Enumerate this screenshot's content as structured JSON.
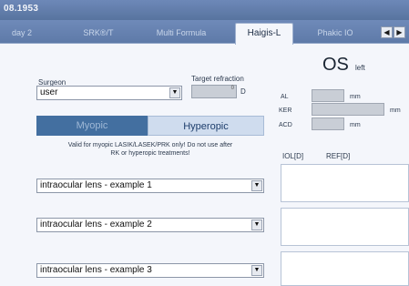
{
  "window": {
    "title": "08.1953"
  },
  "tabs": [
    {
      "label": "day 2"
    },
    {
      "label": "SRK®/T"
    },
    {
      "label": "Multi Formula"
    },
    {
      "label": "Haigis-L"
    },
    {
      "label": "Phakic IO"
    }
  ],
  "tab_nav": {
    "prev": "◀",
    "next": "▶"
  },
  "surgeon": {
    "label": "Surgeon",
    "value": "user"
  },
  "target_refraction": {
    "label": "Target refraction",
    "value": "0",
    "unit": "D"
  },
  "mode_toggle": {
    "myopic": "Myopic",
    "hyperopic": "Hyperopic",
    "selected": "Myopic"
  },
  "validity_note": {
    "line1": "Valid for myopic LASIK/LASEK/PRK only! Do not use after",
    "line2": "RK or hyperopic treatments!"
  },
  "lenses": [
    {
      "value": "intraocular lens - example 1"
    },
    {
      "value": "intraocular lens - example 2"
    },
    {
      "value": "intraocular lens - example 3"
    }
  ],
  "eye": {
    "label": "OS",
    "side": "left"
  },
  "measurements": [
    {
      "label": "AL",
      "unit": "mm"
    },
    {
      "label": "KER",
      "unit": "mm"
    },
    {
      "label": "ACD",
      "unit": "mm"
    }
  ],
  "results": {
    "iol_header": "IOL[D]",
    "ref_header": "REF[D]"
  }
}
